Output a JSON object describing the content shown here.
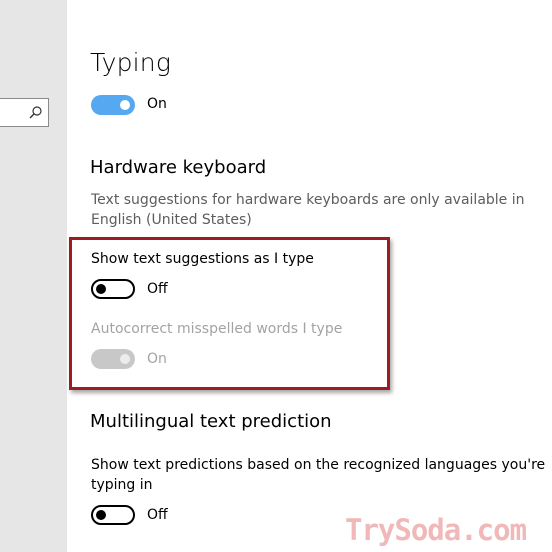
{
  "sidebar": {
    "search_icon": "search-icon"
  },
  "typing": {
    "title": "Typing",
    "toggle_state": "On"
  },
  "hardware": {
    "title": "Hardware keyboard",
    "description_line1": "Text suggestions for hardware keyboards are only available in",
    "description_line2": "English (United States)",
    "show_suggestions_label": "Show text suggestions as I type",
    "show_suggestions_state": "Off",
    "autocorrect_label": "Autocorrect misspelled words I type",
    "autocorrect_state": "On"
  },
  "multilingual": {
    "title": "Multilingual text prediction",
    "label_line1": "Show text predictions based on the recognized languages you're",
    "label_line2": "typing in",
    "state": "Off"
  },
  "watermark": "TrySoda.com",
  "colors": {
    "accent": "#56a9f1",
    "highlight_border": "#9c1c22"
  }
}
